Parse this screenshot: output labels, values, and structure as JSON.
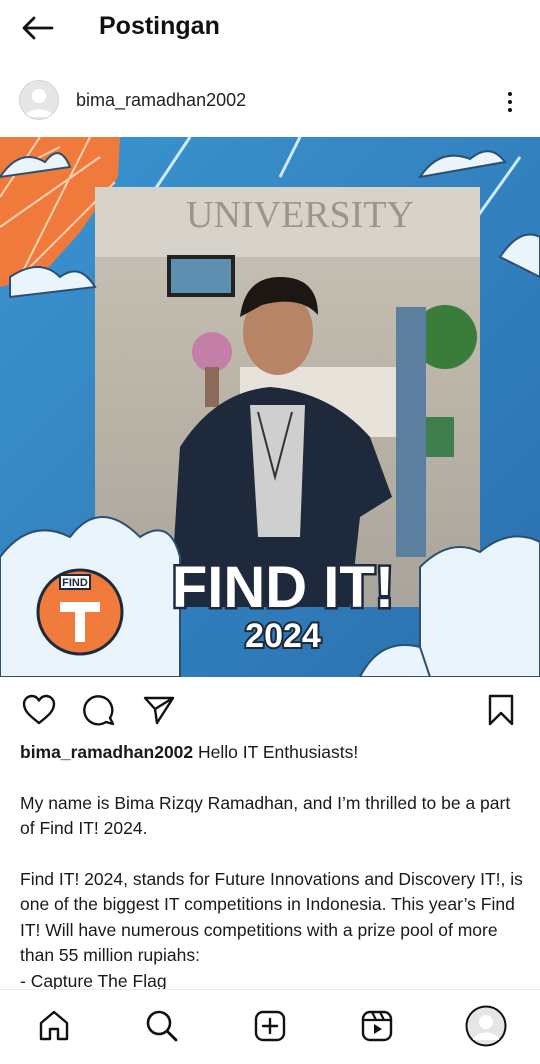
{
  "header": {
    "title": "Postingan"
  },
  "post": {
    "username": "bima_ramadhan2002",
    "image": {
      "banner_title": "FIND IT!",
      "banner_year": "2024",
      "logo_text": "FIND",
      "wall_text": "UNIVERSITY"
    },
    "caption": {
      "username": "bima_ramadhan2002",
      "first_line": "Hello IT Enthusiasts!",
      "paragraph_1": "My name is Bima Rizqy Ramadhan, and I’m thrilled to be a part of Find IT! 2024.",
      "paragraph_2": "Find IT! 2024, stands for Future Innovations and Discovery IT!, is one of the biggest IT competitions in Indonesia. This year’s Find IT! Will have numerous competitions with a prize pool of more than 55 million rupiahs:",
      "list_item_1": "- Capture The Flag"
    }
  },
  "icons": {
    "back": "arrow-left-icon",
    "more": "more-vertical-icon",
    "like": "heart-icon",
    "comment": "comment-icon",
    "share": "send-icon",
    "save": "bookmark-icon",
    "home": "home-icon",
    "search": "search-icon",
    "create": "add-square-icon",
    "reels": "reels-icon",
    "profile": "profile-avatar-icon"
  },
  "colors": {
    "frame_blue": "#2f7fbd",
    "frame_orange": "#f07a3c",
    "banner_fill": "#ffffff",
    "text_primary": "#111111"
  }
}
